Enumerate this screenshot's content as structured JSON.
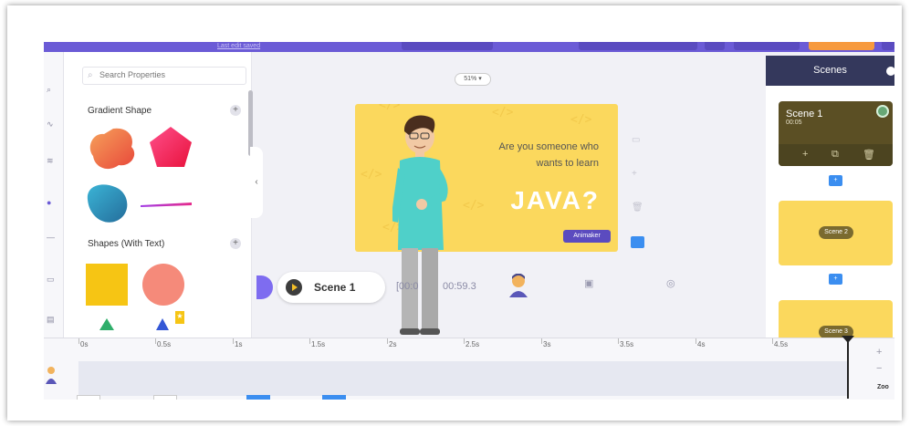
{
  "topbar": {
    "saved_link": "Last edit saved"
  },
  "properties": {
    "search_placeholder": "Search Properties",
    "section_gradient": "Gradient Shape",
    "section_shapes_text": "Shapes (With Text)"
  },
  "stage": {
    "zoom": "51% ▾",
    "headline_line1": "Are you someone who",
    "headline_line2": "wants to learn",
    "big_word": "JAVA?",
    "badge": "Animaker"
  },
  "playback": {
    "scene_label": "Scene 1",
    "current_time": "[00:0",
    "total_time": "00:59.3"
  },
  "scenes_panel": {
    "title": "Scenes",
    "items": [
      {
        "name": "Scene 1",
        "duration": "00:05"
      },
      {
        "name": "Scene 2"
      },
      {
        "name": "Scene 3"
      }
    ]
  },
  "timeline": {
    "ticks": [
      "0s",
      "0.5s",
      "1s",
      "1.5s",
      "2s",
      "2.5s",
      "3s",
      "3.5s",
      "4s",
      "4.5s"
    ],
    "zoom_label": "Zoo"
  },
  "colors": {
    "accent": "#6b5bd6",
    "canvas_bg": "#fbd85d",
    "scenes_header": "#34385c",
    "blue": "#3b8ef0"
  }
}
